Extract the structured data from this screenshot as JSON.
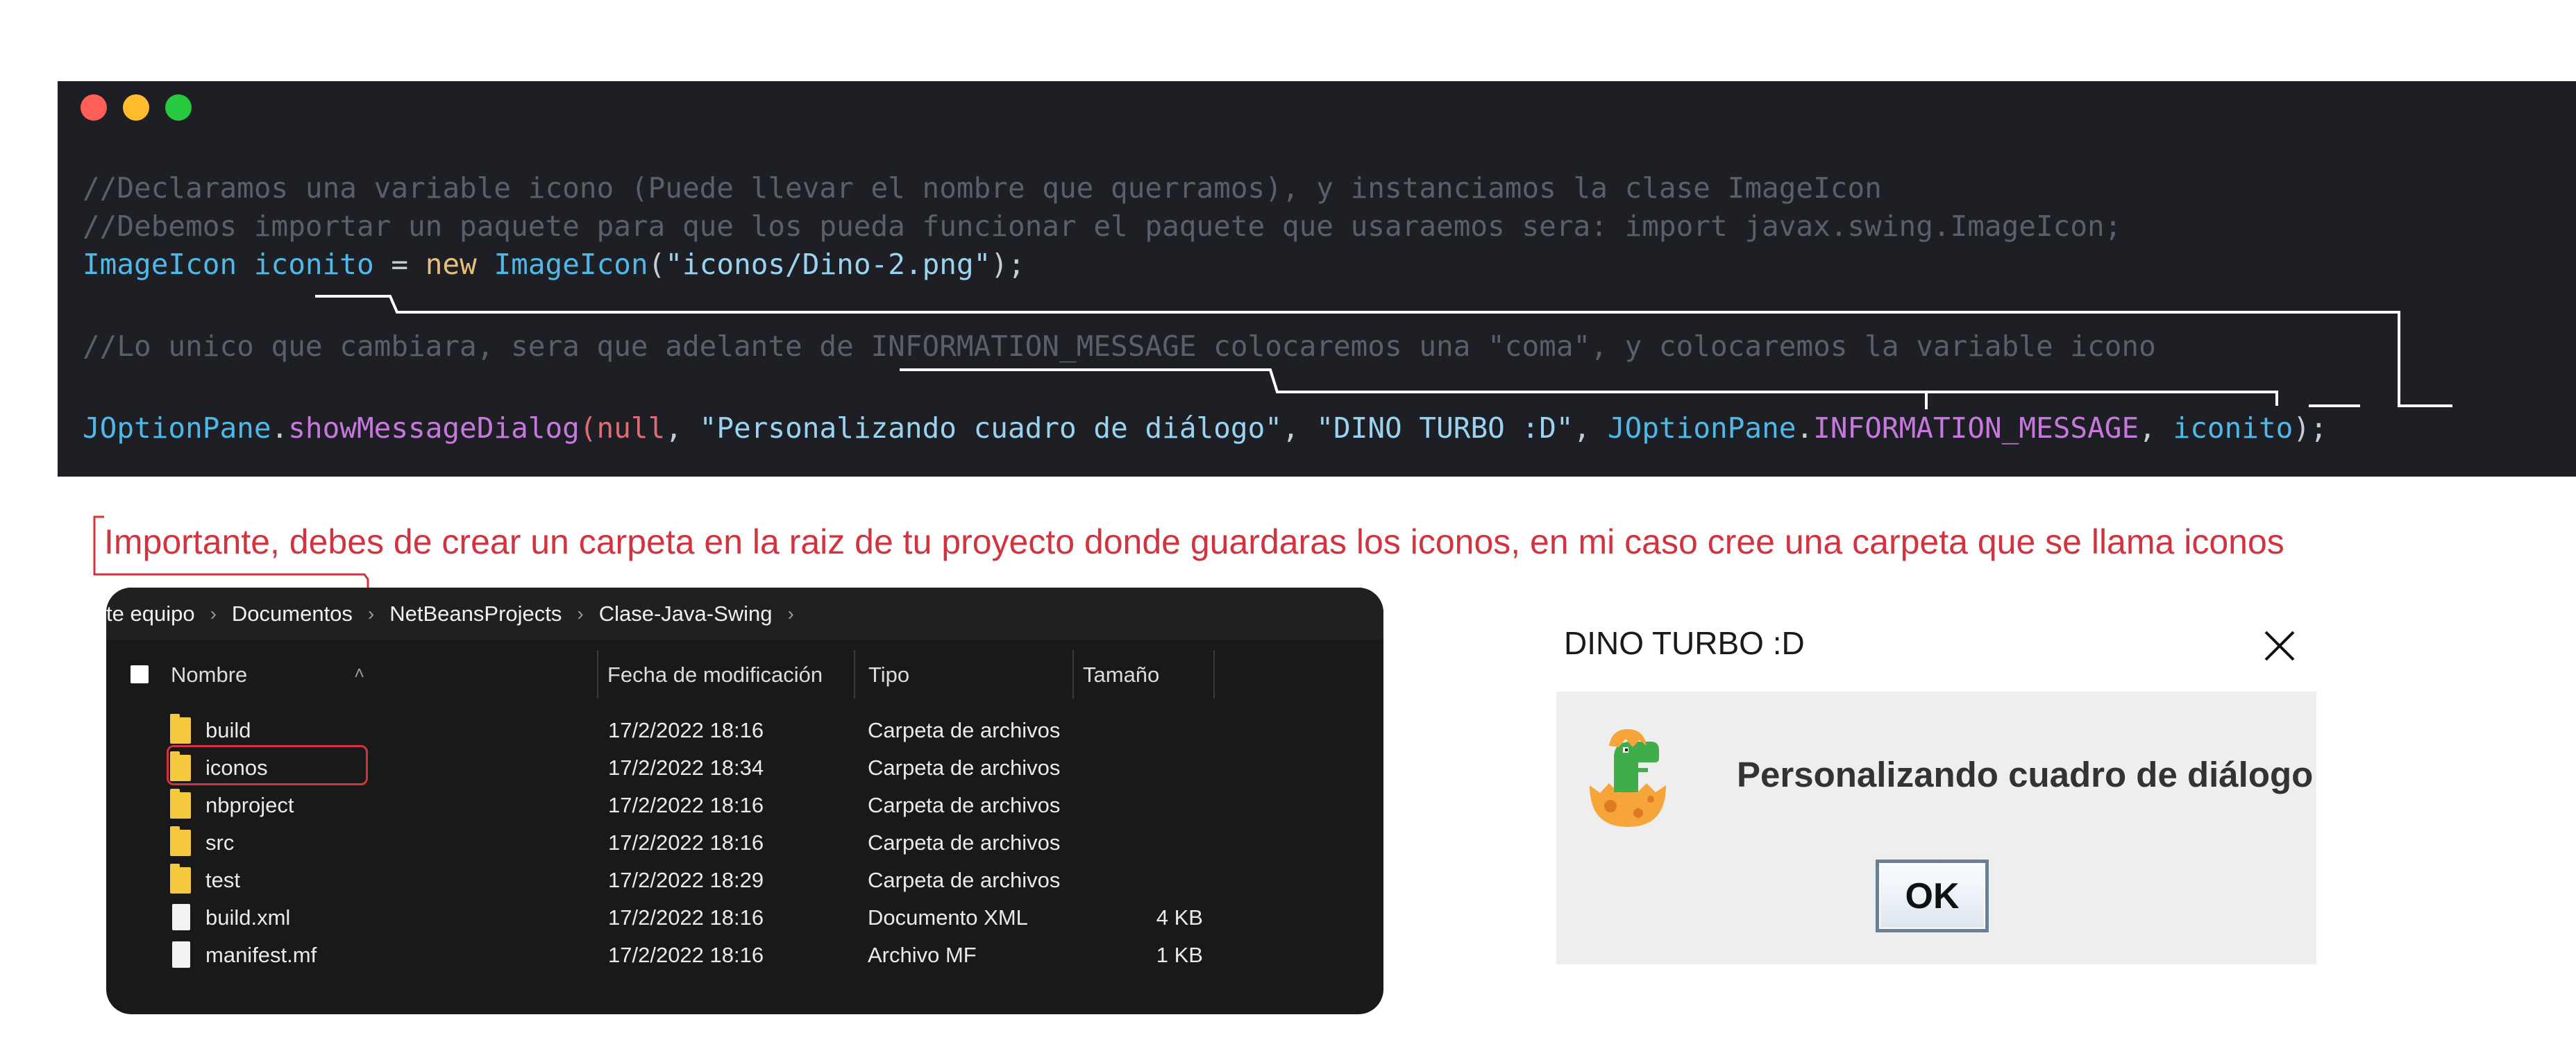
{
  "code_window": {
    "dots_colors": [
      "#ff5f56",
      "#ffbd2e",
      "#27c93f"
    ],
    "comment_1": "//Declaramos una variable icono (Puede llevar el nombre que querramos), y instanciamos la clase ImageIcon",
    "comment_2": "//Debemos importar un paquete para que los pueda funcionar el paquete que usaraemos sera: import javax.swing.ImageIcon;",
    "line_3": {
      "type": "ImageIcon",
      "var": "iconito",
      "op": " = ",
      "kw": "new",
      "ctor": "ImageIcon",
      "open": "(",
      "str": "\"iconos/Dino-2.png\"",
      "close": ");"
    },
    "comment_3": "//Lo unico que cambiara, sera que adelante de INFORMATION_MESSAGE colocaremos una \"coma\", y colocaremos la variable icono",
    "line_5": {
      "cls": "JOptionPane",
      "dot1": ".",
      "method": "showMessageDialog",
      "open": "(",
      "null": "null",
      "sep1": ", ",
      "str1": "\"Personalizando cuadro de diálogo\"",
      "sep2": ", ",
      "str2": "\"DINO TURBO :D\"",
      "sep3": ", ",
      "cls2": "JOptionPane",
      "dot2": ".",
      "const": "INFORMATION_MESSAGE",
      "sep4": ", ",
      "var": "iconito",
      "close": ");"
    }
  },
  "note": "Importante, debes de crear un carpeta en la raiz de tu proyecto donde guardaras los iconos, en mi caso cree una carpeta que se llama iconos",
  "explorer": {
    "breadcrumb": [
      "te equipo",
      "Documentos",
      "NetBeansProjects",
      "Clase-Java-Swing"
    ],
    "columns": {
      "name": "Nombre",
      "modified": "Fecha de modificación",
      "type": "Tipo",
      "size": "Tamaño"
    },
    "rows": [
      {
        "name": "build",
        "modified": "17/2/2022 18:16",
        "type": "Carpeta de archivos",
        "size": "",
        "icon": "folder-icon"
      },
      {
        "name": "iconos",
        "modified": "17/2/2022 18:34",
        "type": "Carpeta de archivos",
        "size": "",
        "icon": "folder-icon"
      },
      {
        "name": "nbproject",
        "modified": "17/2/2022 18:16",
        "type": "Carpeta de archivos",
        "size": "",
        "icon": "folder-icon"
      },
      {
        "name": "src",
        "modified": "17/2/2022 18:16",
        "type": "Carpeta de archivos",
        "size": "",
        "icon": "folder-icon"
      },
      {
        "name": "test",
        "modified": "17/2/2022 18:29",
        "type": "Carpeta de archivos",
        "size": "",
        "icon": "folder-icon"
      },
      {
        "name": "build.xml",
        "modified": "17/2/2022 18:16",
        "type": "Documento XML",
        "size": "4 KB",
        "icon": "document-icon"
      },
      {
        "name": "manifest.mf",
        "modified": "17/2/2022 18:16",
        "type": "Archivo MF",
        "size": "1 KB",
        "icon": "document-icon"
      }
    ],
    "highlighted_row": "iconos"
  },
  "dialog": {
    "title": "DINO TURBO :D",
    "message": "Personalizando cuadro de diálogo",
    "ok_label": "OK",
    "icon": "dino-egg-icon"
  },
  "colors": {
    "code_bg": "#1e1f24",
    "accent_red": "#d2343f",
    "explorer_bg": "#191919",
    "dialog_bg": "#eeeeee"
  }
}
